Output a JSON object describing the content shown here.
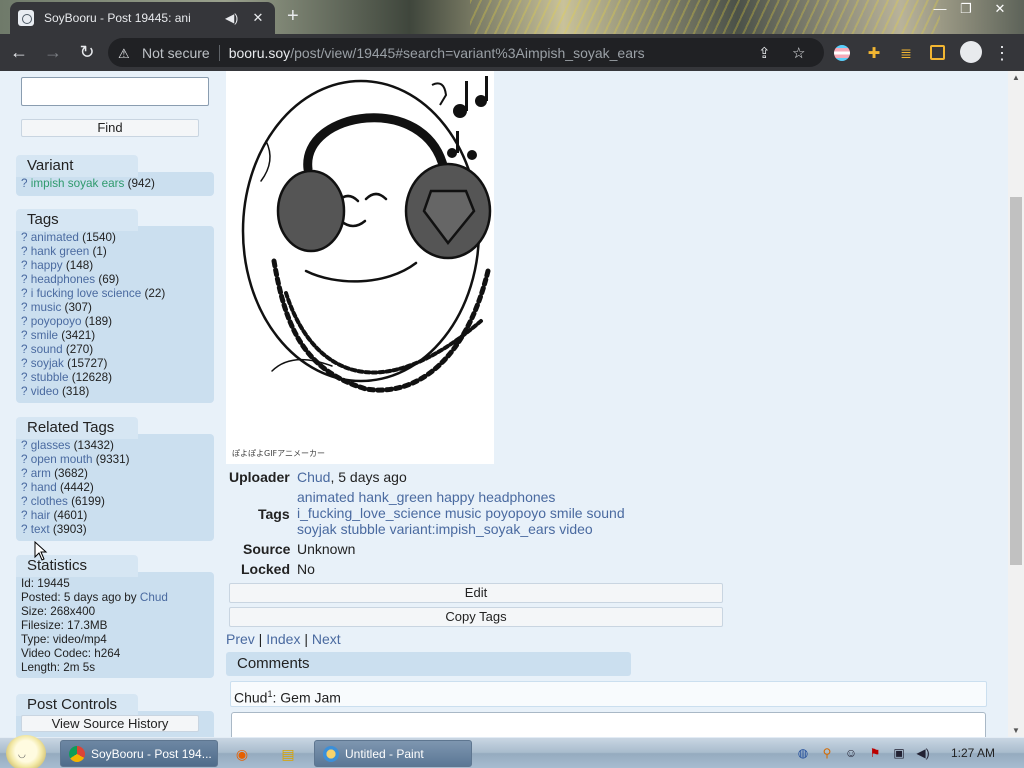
{
  "browser": {
    "tab_title": "SoyBooru - Post 19445: ani",
    "tab_audio_icon": "speaker-icon",
    "tab_close": "✕",
    "new_tab": "+",
    "address_security": "Not secure",
    "address_host": "booru.soy",
    "address_path": "/post/view/19445#search=variant%3Aimpish_soyak_ears",
    "window_controls": [
      "minimize-icon",
      "maximize-icon",
      "close-icon"
    ]
  },
  "sidebar": {
    "find_label": "Find",
    "variant": {
      "heading": "Variant",
      "items": [
        {
          "q": "?",
          "name": "impish soyak ears",
          "count": "(942)"
        }
      ]
    },
    "tags": {
      "heading": "Tags",
      "items": [
        {
          "q": "?",
          "name": "animated",
          "count": "(1540)"
        },
        {
          "q": "?",
          "name": "hank green",
          "count": "(1)"
        },
        {
          "q": "?",
          "name": "happy",
          "count": "(148)"
        },
        {
          "q": "?",
          "name": "headphones",
          "count": "(69)"
        },
        {
          "q": "?",
          "name": "i fucking love science",
          "count": "(22)"
        },
        {
          "q": "?",
          "name": "music",
          "count": "(307)"
        },
        {
          "q": "?",
          "name": "poyopoyo",
          "count": "(189)"
        },
        {
          "q": "?",
          "name": "smile",
          "count": "(3421)"
        },
        {
          "q": "?",
          "name": "sound",
          "count": "(270)"
        },
        {
          "q": "?",
          "name": "soyjak",
          "count": "(15727)"
        },
        {
          "q": "?",
          "name": "stubble",
          "count": "(12628)"
        },
        {
          "q": "?",
          "name": "video",
          "count": "(318)"
        }
      ]
    },
    "related_tags": {
      "heading": "Related Tags",
      "items": [
        {
          "q": "?",
          "name": "glasses",
          "count": "(13432)"
        },
        {
          "q": "?",
          "name": "open mouth",
          "count": "(9331)"
        },
        {
          "q": "?",
          "name": "arm",
          "count": "(3682)"
        },
        {
          "q": "?",
          "name": "hand",
          "count": "(4442)"
        },
        {
          "q": "?",
          "name": "clothes",
          "count": "(6199)"
        },
        {
          "q": "?",
          "name": "hair",
          "count": "(4601)"
        },
        {
          "q": "?",
          "name": "text",
          "count": "(3903)"
        }
      ]
    },
    "statistics": {
      "heading": "Statistics",
      "id": "Id: 19445",
      "posted_prefix": "Posted: 5 days ago by ",
      "posted_user": "Chud",
      "size": "Size: 268x400",
      "filesize": "Filesize: 17.3MB",
      "type": "Type: video/mp4",
      "codec": "Video Codec: h264",
      "length": "Length: 2m 5s"
    },
    "post_controls": {
      "heading": "Post Controls",
      "view_source_history": "View Source History"
    }
  },
  "post": {
    "image_watermark": "ぽよぽよGIFアニメーカー",
    "uploader_label": "Uploader",
    "uploader_name": "Chud",
    "uploader_time": ", 5 days ago",
    "tags_label": "Tags",
    "tags_line1": "animated hank_green happy headphones",
    "tags_line2": "i_fucking_love_science music poyopoyo smile sound",
    "tags_line3": "soyjak stubble variant:impish_soyak_ears video",
    "source_label": "Source",
    "source_value": "Unknown",
    "locked_label": "Locked",
    "locked_value": "No",
    "edit_label": "Edit",
    "copy_tags_label": "Copy Tags",
    "pager": {
      "prev": "Prev",
      "sep1": " | ",
      "index": "Index",
      "sep2": " | ",
      "next": "Next"
    }
  },
  "comments": {
    "heading": "Comments",
    "items": [
      {
        "user": "Chud",
        "sup": "1",
        "text": ": Gem Jam"
      }
    ]
  },
  "taskbar": {
    "tasks": [
      {
        "label": "SoyBooru - Post 194..."
      },
      {
        "label": "Untitled - Paint"
      }
    ],
    "clock": "1:27 AM"
  },
  "colors": {
    "page_bg": "#e8f1f9",
    "block_bg": "#cbdfef",
    "link": "#4a6aa0",
    "variant_link": "#2f9a6d",
    "chrome_dark": "#35363a"
  }
}
